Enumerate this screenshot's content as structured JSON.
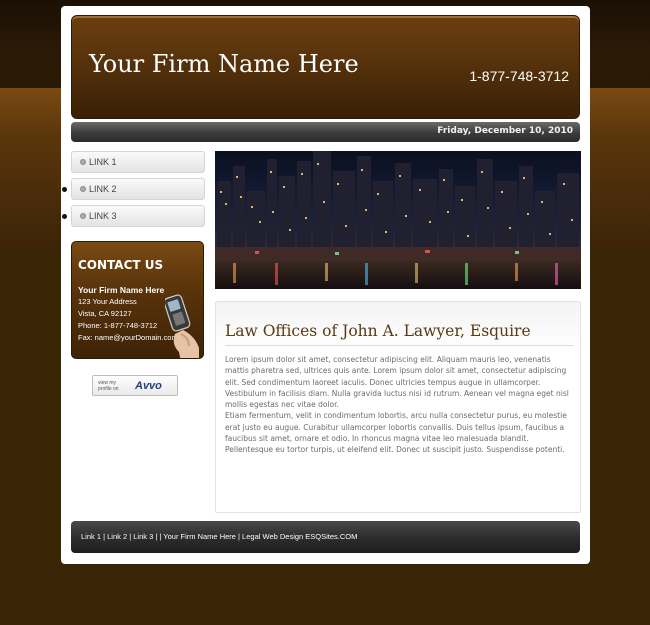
{
  "header": {
    "firm_name": "Your Firm Name Here",
    "phone": "1-877-748-3712"
  },
  "datebar": {
    "date": "Friday, December 10, 2010"
  },
  "nav": {
    "items": [
      {
        "label": "LINK 1"
      },
      {
        "label": "LINK 2"
      },
      {
        "label": "LINK 3"
      }
    ]
  },
  "contact": {
    "title": "CONTACT US",
    "firm": "Your Firm Name Here",
    "address1": "123 Your Address",
    "address2": "Vista, CA 92127",
    "phone": "Phone: 1-877-748-3712",
    "fax": "Fax: name@yourDomain.com"
  },
  "avvo": {
    "small_text": "view my profile on",
    "logo": "Avvo"
  },
  "main": {
    "title": "Law Offices of John A. Lawyer, Esquire",
    "paragraph1": "Lorem ipsum dolor sit amet, consectetur adipiscing elit. Aliquam mauris leo, venenatis mattis pharetra sed, ultrices quis ante. Lorem ipsum dolor sit amet, consectetur adipiscing elit. Sed condimentum laoreet iaculis. Donec ultricies tempus augue in ullamcorper. Vestibulum in facilisis diam. Nulla gravida luctus nisi id rutrum. Aenean vel magna eget nisl mollis egestas nec vitae dolor.",
    "paragraph2": "Etiam fermentum, velit in condimentum lobortis, arcu nulla consectetur purus, eu molestie erat justo eu augue. Curabitur ullamcorper lobortis convallis. Duis tellus ipsum, faucibus a faucibus sit amet, ornare et odio. In rhoncus magna vitae leo malesuada blandit. Pellentesque eu tortor turpis, ut eleifend elit. Donec ut suscipit justo. Suspendisse potenti."
  },
  "footer": {
    "text": "Link 1  |  Link 2  |  Link 3  |  | Your Firm Name Here | Legal Web Design ESQSites.COM"
  },
  "colors": {
    "brown_dark": "#3b2507",
    "brown_header": "#56320c",
    "title_brown": "#5a3a12",
    "bar_gray": "#3c3c3c"
  }
}
